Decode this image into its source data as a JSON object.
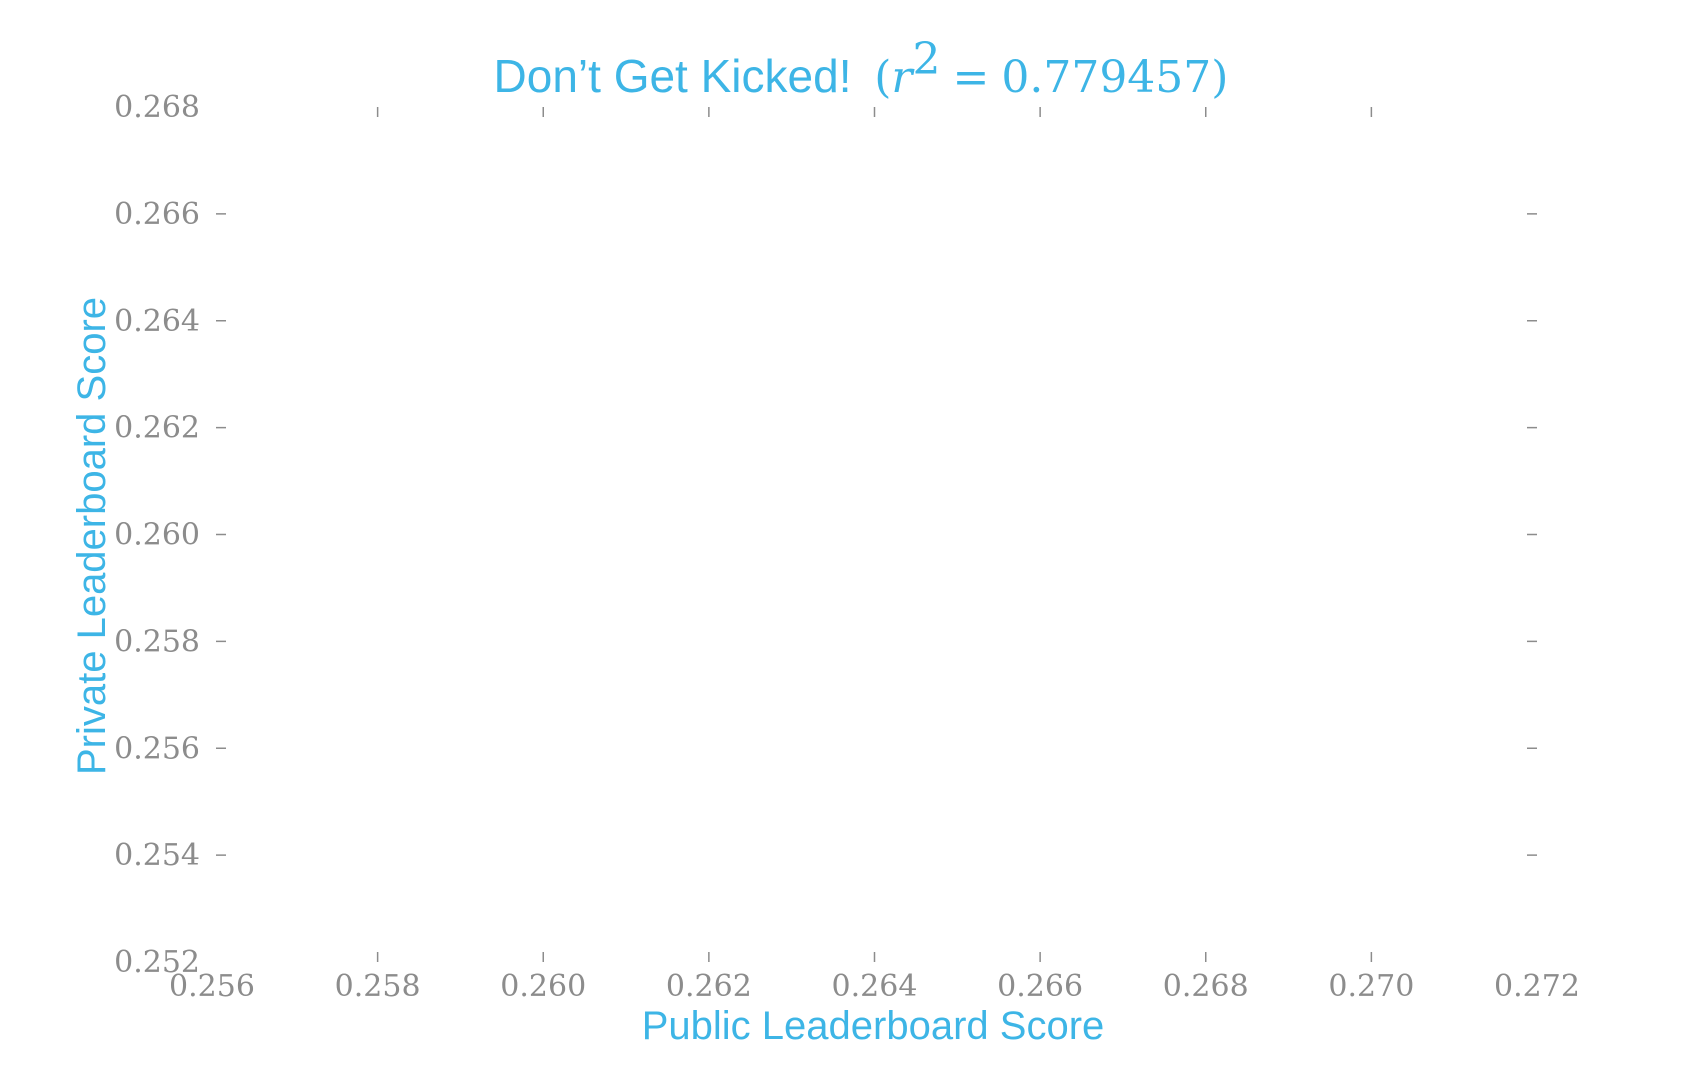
{
  "chart_data": {
    "type": "scatter",
    "title": "Don’t Get Kicked! (r² = 0.779457)",
    "title_parts": {
      "text": "Don’t Get Kicked!",
      "stat_symbol": "r",
      "stat_exponent": "2",
      "stat_value": "0.779457"
    },
    "xlabel": "Public Leaderboard Score",
    "ylabel": "Private Leaderboard Score",
    "xlim": [
      0.256,
      0.272
    ],
    "ylim": [
      0.252,
      0.268
    ],
    "x_ticks": [
      "0.256",
      "0.258",
      "0.260",
      "0.262",
      "0.264",
      "0.266",
      "0.268",
      "0.270",
      "0.272"
    ],
    "y_ticks": [
      "0.252",
      "0.254",
      "0.256",
      "0.258",
      "0.260",
      "0.262",
      "0.264",
      "0.266",
      "0.268"
    ],
    "series": [],
    "grid": false,
    "colors": {
      "title": "#3db5e6",
      "axis_label": "#3db5e6",
      "tick": "#8c8c8c"
    }
  }
}
